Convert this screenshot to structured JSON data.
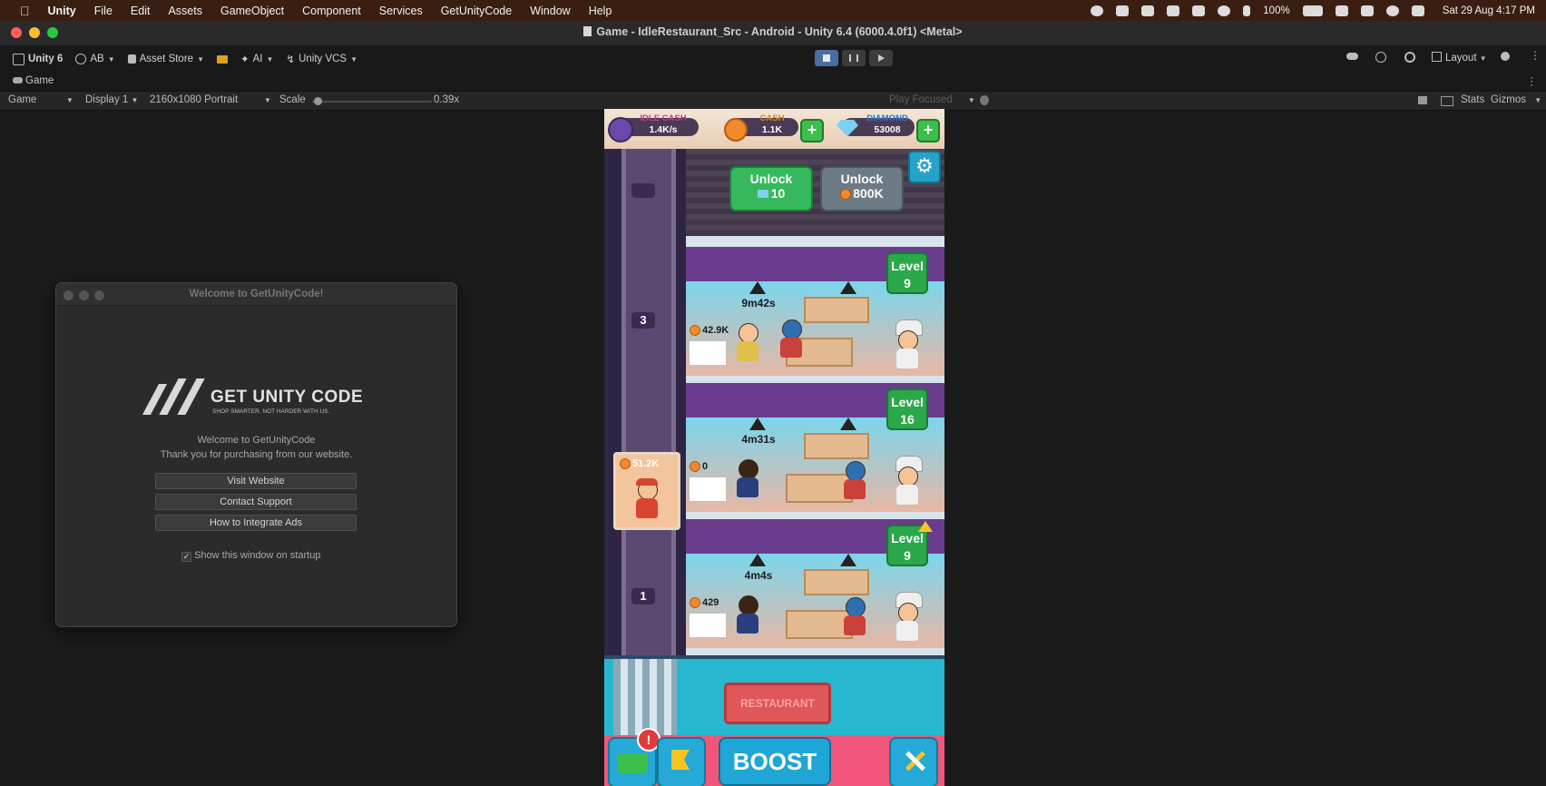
{
  "menubar": {
    "app": "Unity",
    "items": [
      "File",
      "Edit",
      "Assets",
      "GameObject",
      "Component",
      "Services",
      "GetUnityCode",
      "Window",
      "Help"
    ],
    "battery": "100%",
    "clock": "Sat 29 Aug  4:17 PM"
  },
  "window": {
    "title": "Game - IdleRestaurant_Src - Android - Unity 6.4 (6000.4.0f1) <Metal>"
  },
  "toolbar": {
    "unity_label": "Unity 6",
    "account": "AB",
    "asset_store": "Asset Store",
    "ai": "AI",
    "vcs": "Unity VCS",
    "layout": "Layout"
  },
  "tabbar": {
    "game_tab": "Game"
  },
  "gamebar": {
    "view": "Game",
    "display": "Display 1",
    "resolution": "2160x1080 Portrait",
    "scale_label": "Scale",
    "scale_value": "0.39x",
    "scale_fraction": 0.02,
    "play_mode": "Play Focused",
    "stats": "Stats",
    "gizmos": "Gizmos"
  },
  "dialog": {
    "title": "Welcome to GetUnityCode!",
    "logo_text": "GET UNITY CODE",
    "logo_tagline": "SHOP SMARTER. NOT HARDER WITH US.",
    "welcome": "Welcome to GetUnityCode",
    "thanks": "Thank you for purchasing from our website.",
    "buttons": [
      "Visit Website",
      "Contact Support",
      "How to Integrate Ads"
    ],
    "startup_checkbox": "Show this window on startup",
    "startup_checked": true
  },
  "game": {
    "hud": {
      "idle_cash_label": "IDLE CASH",
      "idle_cash_value": "1.4K/s",
      "cash_label": "CASH",
      "cash_value": "1.1K",
      "diamond_label": "DIAMOND",
      "diamond_value": "53008",
      "plus": "+"
    },
    "unlock_diamond": {
      "label": "Unlock",
      "cost": "10"
    },
    "unlock_cash": {
      "label": "Unlock",
      "cost": "800K"
    },
    "elevator": {
      "floor_top": "3",
      "floor_bottom": "1",
      "carry": "51.2K"
    },
    "floors": [
      {
        "level_label": "Level",
        "level": "9",
        "timer": "9m42s",
        "earnings": "42.9K"
      },
      {
        "level_label": "Level",
        "level": "16",
        "timer": "4m31s",
        "earnings": "0"
      },
      {
        "level_label": "Level",
        "level": "9",
        "timer": "4m4s",
        "earnings": "429"
      }
    ],
    "restaurant_sign": "RESTAURANT",
    "boost": "BOOST",
    "alert": "!"
  },
  "colors": {
    "menubar_bg": "#3a1e12",
    "play_active": "#4a6ea4",
    "level_green": "#2aa84a",
    "boost_blue": "#1ea6d6"
  }
}
